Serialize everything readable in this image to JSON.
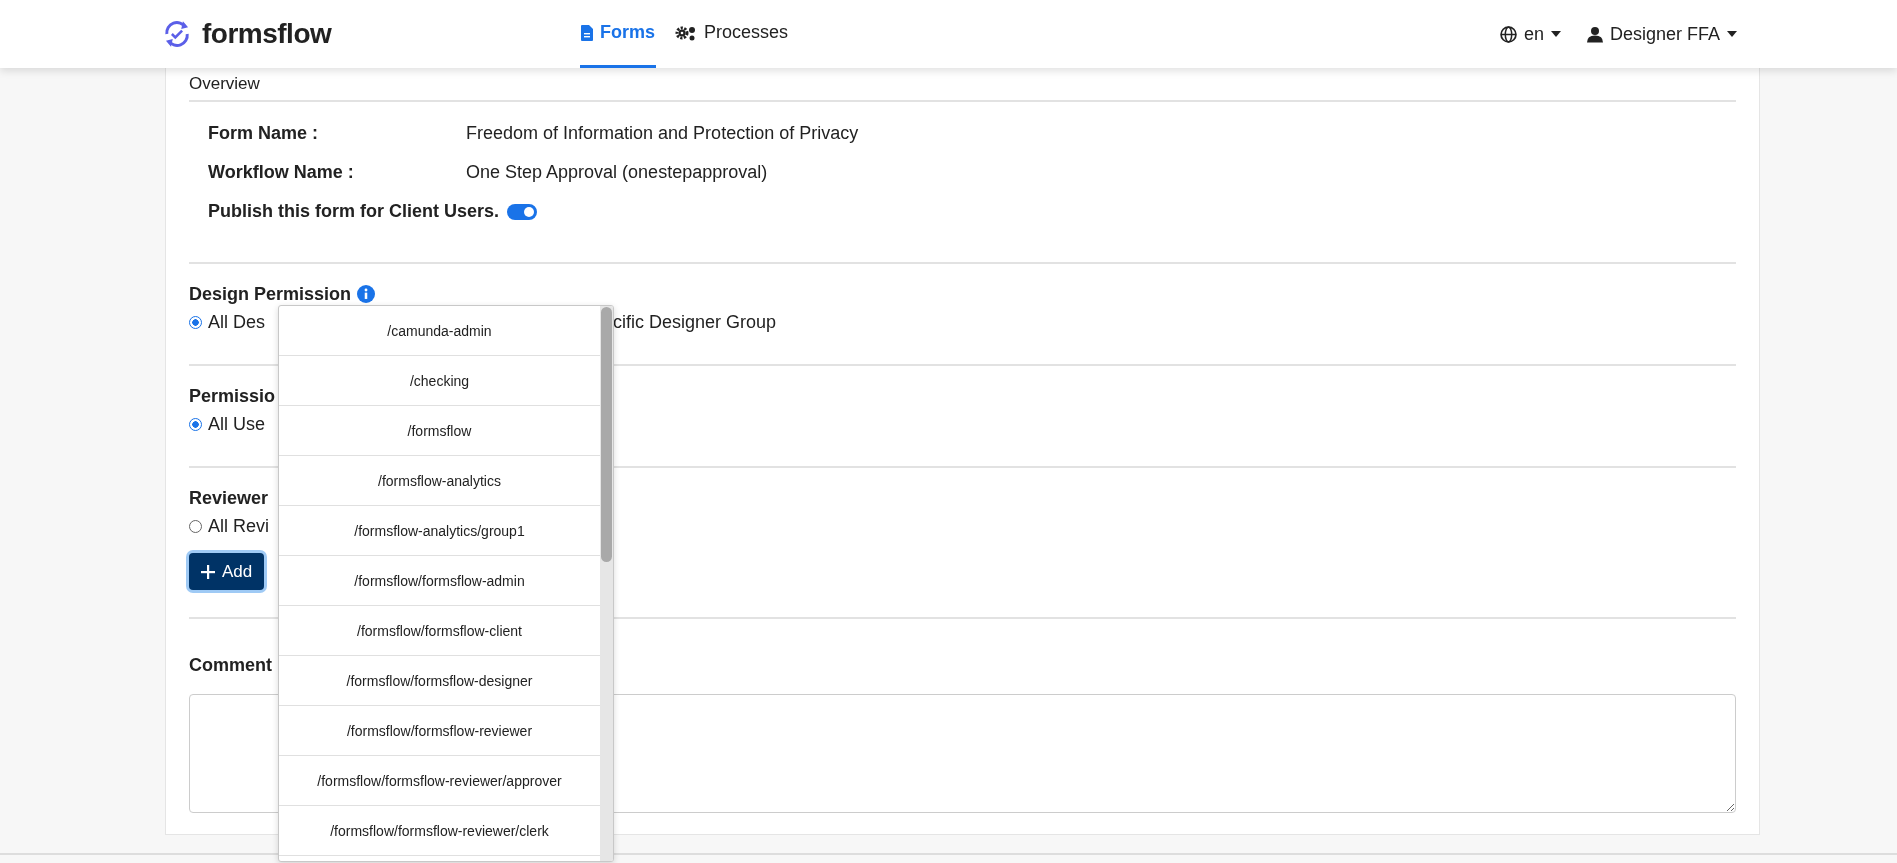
{
  "header": {
    "logo": "formsflow",
    "nav": [
      {
        "label": "Forms",
        "selected": true
      },
      {
        "label": "Processes",
        "selected": false
      }
    ],
    "language": "en",
    "user": "Designer FFA"
  },
  "overview": {
    "title": "Overview",
    "rows": [
      {
        "label": "Form Name :",
        "value": "Freedom of Information and Protection of Privacy"
      },
      {
        "label": "Workflow Name :",
        "value": "One Step Approval (onestepapproval)"
      }
    ],
    "publish": {
      "label": "Publish this form for Client Users.",
      "on": true
    }
  },
  "sections": [
    {
      "kind": "options",
      "title": "Design Permission",
      "info": true,
      "options": [
        {
          "kind": "radio",
          "label": "All Des",
          "selected": true
        },
        {
          "kind": "text",
          "label": "cific Designer Group"
        }
      ]
    },
    {
      "kind": "options",
      "title": "Permissio",
      "options": [
        {
          "kind": "radio",
          "label": "All Use",
          "selected": true
        }
      ]
    },
    {
      "kind": "options",
      "title": "Reviewer",
      "options": [
        {
          "kind": "radio",
          "label": "All Revi",
          "selected": false
        }
      ],
      "add_button": "Add"
    },
    {
      "kind": "comment",
      "title": "Comment"
    }
  ],
  "dropdown": {
    "items": [
      "/camunda-admin",
      "/checking",
      "/formsflow",
      "/formsflow-analytics",
      "/formsflow-analytics/group1",
      "/formsflow/formsflow-admin",
      "/formsflow/formsflow-client",
      "/formsflow/formsflow-designer",
      "/formsflow/formsflow-reviewer",
      "/formsflow/formsflow-reviewer/approver",
      "/formsflow/formsflow-reviewer/clerk"
    ]
  }
}
